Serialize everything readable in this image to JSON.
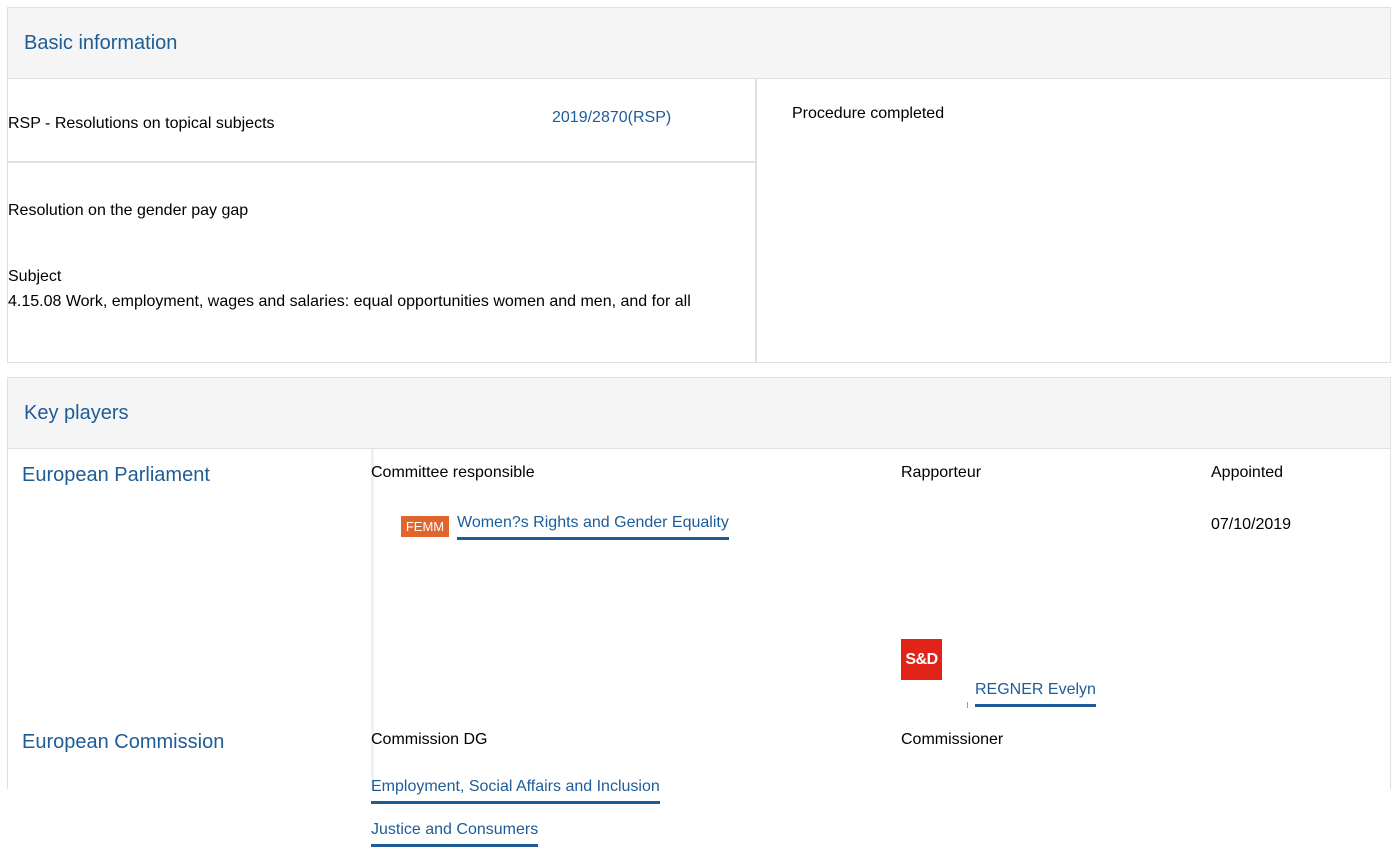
{
  "basic": {
    "header": "Basic information",
    "procedure_type": "RSP - Resolutions on topical subjects",
    "reference": "2019/2870(RSP)",
    "status": "Procedure completed",
    "title": "Resolution on the gender pay gap",
    "subject_label": "Subject",
    "subject_value": "4.15.08 Work, employment, wages and salaries: equal opportunities women and men, and for all"
  },
  "players": {
    "header": "Key players",
    "parliament": {
      "label": "European Parliament",
      "committee_label": "Committee responsible",
      "rapporteur_label": "Rapporteur",
      "appointed_label": "Appointed",
      "committee_badge": "FEMM",
      "committee_name": "Women?s Rights and Gender Equality",
      "appointed_date": "07/10/2019",
      "group_logo": "S&D",
      "rapporteur_name": "REGNER Evelyn"
    },
    "commission": {
      "label": "European Commission",
      "dg_label": "Commission DG",
      "commissioner_label": "Commissioner",
      "dgs": [
        "Employment, Social Affairs and Inclusion",
        "Justice and Consumers"
      ]
    }
  },
  "colors": {
    "link": "#1e5c97",
    "badge": "#e0662e",
    "logo": "#e2231a",
    "border": "#e0e0e0",
    "header_bg": "#f5f5f5"
  }
}
